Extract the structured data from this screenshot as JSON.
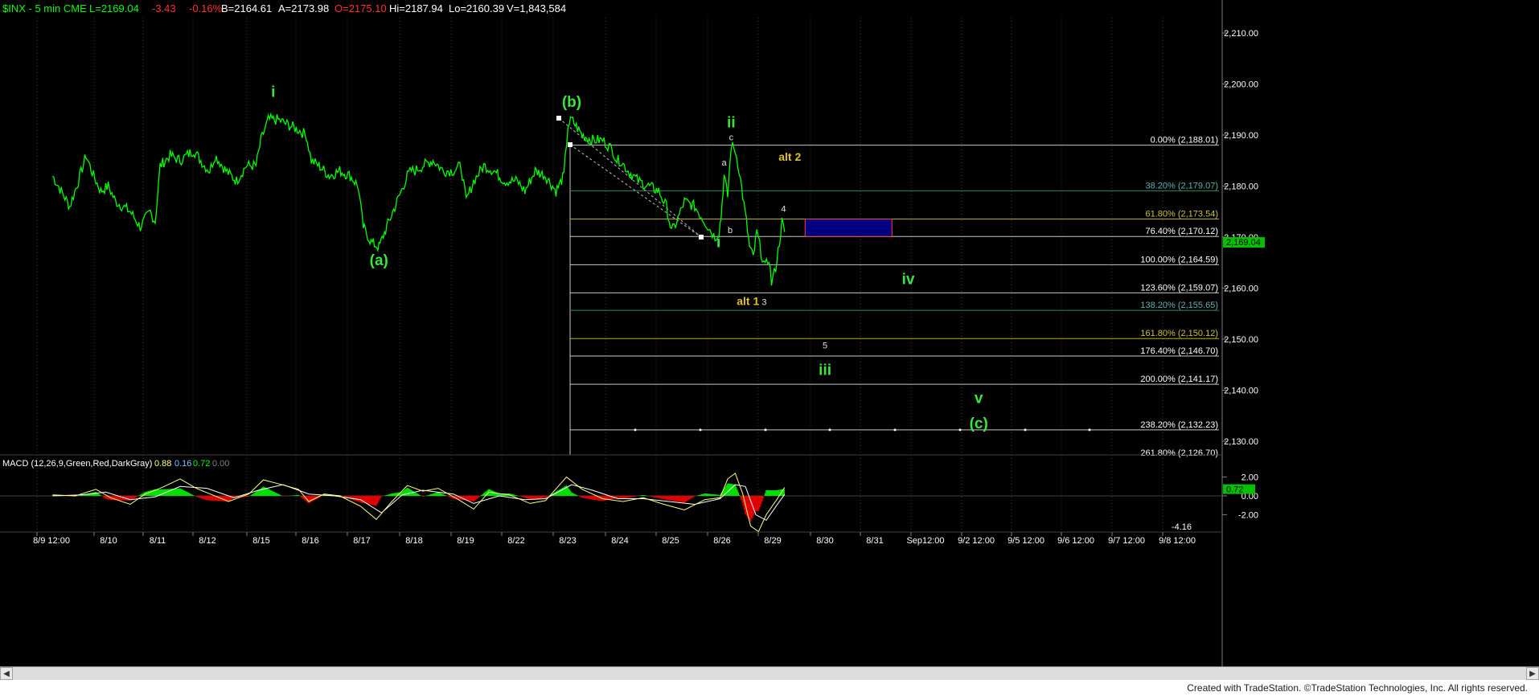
{
  "header": {
    "symbol": "$INX - 5 min  CME",
    "last": "L=2169.04",
    "change": "-3.43",
    "pct": "-0.16%",
    "bid": "B=2164.61",
    "ask": "A=2173.98",
    "open": "O=2175.10",
    "high": "Hi=2187.94",
    "low": "Lo=2160.39",
    "volume": "V=1,843,584"
  },
  "macd_header": {
    "name": "MACD (12,26,9,Green,Red,DarkGray)",
    "v1": "0.88",
    "v2": "0.16",
    "v3": "0.72",
    "v4": "0.00"
  },
  "colors": {
    "price": "#00ff00",
    "label_green": "#39e639",
    "label_yellow": "#e0c020",
    "header_green": "#00ff00",
    "header_red": "#ff3030",
    "fib_white": "#ffffff",
    "fib_green": "#2e8b57",
    "fib_yellow": "#b8b000",
    "box_fill": "#000080",
    "box_border": "#ff4040",
    "macd_line": "#ffff80",
    "macd_signal": "#ffffff",
    "hist_pos": "#00e000",
    "hist_neg": "#e00000",
    "axis_bg": "#000000"
  },
  "footer": {
    "credit": "Created with TradeStation. ©TradeStation Technologies, Inc. All rights reserved."
  },
  "chart_data": {
    "type": "line",
    "title": "$INX - 5 min",
    "x_ticks": [
      "8/9 12:00",
      "8/10",
      "8/11",
      "8/12",
      "8/15",
      "8/16",
      "8/17",
      "8/18",
      "8/19",
      "8/22",
      "8/23",
      "8/24",
      "8/25",
      "8/26",
      "8/29",
      "8/30",
      "8/31",
      "Sep12:00",
      "9/2 12:00",
      "9/5 12:00",
      "9/6 12:00",
      "9/7 12:00",
      "9/8 12:00"
    ],
    "y_ticks": [
      2130,
      2140,
      2150,
      2160,
      2170,
      2180,
      2190,
      2200,
      2210
    ],
    "ylim": [
      2125,
      2215
    ],
    "last_price": "2,169.04",
    "price_points": [
      [
        0.0,
        2182
      ],
      [
        0.15,
        2179
      ],
      [
        0.3,
        2176
      ],
      [
        0.45,
        2181
      ],
      [
        0.6,
        2186
      ],
      [
        0.75,
        2182
      ],
      [
        0.9,
        2179
      ],
      [
        1.05,
        2180
      ],
      [
        1.2,
        2177
      ],
      [
        1.5,
        2175
      ],
      [
        1.7,
        2172
      ],
      [
        1.9,
        2175
      ],
      [
        2.0,
        2173
      ],
      [
        2.1,
        2184
      ],
      [
        2.3,
        2186
      ],
      [
        2.5,
        2185
      ],
      [
        2.75,
        2187
      ],
      [
        2.95,
        2184
      ],
      [
        3.05,
        2183
      ],
      [
        3.15,
        2186
      ],
      [
        3.35,
        2183
      ],
      [
        3.55,
        2181
      ],
      [
        3.75,
        2184
      ],
      [
        3.95,
        2184
      ],
      [
        4.05,
        2189
      ],
      [
        4.2,
        2193
      ],
      [
        4.4,
        2193
      ],
      [
        4.6,
        2192
      ],
      [
        4.8,
        2191
      ],
      [
        4.95,
        2190
      ],
      [
        5.05,
        2185
      ],
      [
        5.2,
        2184
      ],
      [
        5.4,
        2182
      ],
      [
        5.6,
        2183
      ],
      [
        5.8,
        2182
      ],
      [
        5.95,
        2180
      ],
      [
        6.05,
        2172
      ],
      [
        6.2,
        2169
      ],
      [
        6.35,
        2168
      ],
      [
        6.5,
        2172
      ],
      [
        6.7,
        2177
      ],
      [
        6.9,
        2182
      ],
      [
        6.98,
        2183
      ],
      [
        7.05,
        2183
      ],
      [
        7.2,
        2184
      ],
      [
        7.4,
        2185
      ],
      [
        7.6,
        2183
      ],
      [
        7.8,
        2183
      ],
      [
        7.95,
        2184
      ],
      [
        8.05,
        2177
      ],
      [
        8.2,
        2181
      ],
      [
        8.4,
        2184
      ],
      [
        8.6,
        2183
      ],
      [
        8.8,
        2181
      ],
      [
        8.95,
        2181
      ],
      [
        9.05,
        2181
      ],
      [
        9.2,
        2179
      ],
      [
        9.4,
        2183
      ],
      [
        9.6,
        2182
      ],
      [
        9.8,
        2179
      ],
      [
        9.95,
        2182
      ],
      [
        10.03,
        2192
      ],
      [
        10.1,
        2193
      ],
      [
        10.3,
        2190
      ],
      [
        10.5,
        2189
      ],
      [
        10.7,
        2189
      ],
      [
        10.9,
        2187
      ],
      [
        10.98,
        2185
      ],
      [
        11.05,
        2185
      ],
      [
        11.2,
        2183
      ],
      [
        11.4,
        2181
      ],
      [
        11.6,
        2180
      ],
      [
        11.8,
        2179
      ],
      [
        11.95,
        2176
      ],
      [
        12.05,
        2171
      ],
      [
        12.15,
        2173
      ],
      [
        12.3,
        2177
      ],
      [
        12.5,
        2176
      ],
      [
        12.7,
        2173
      ],
      [
        12.9,
        2170
      ],
      [
        12.98,
        2171
      ],
      [
        13.02,
        2174
      ],
      [
        13.08,
        2182
      ],
      [
        13.15,
        2178
      ],
      [
        13.22,
        2188
      ],
      [
        13.3,
        2187
      ],
      [
        13.38,
        2183
      ],
      [
        13.45,
        2178
      ],
      [
        13.52,
        2173
      ],
      [
        13.58,
        2168
      ],
      [
        13.65,
        2166
      ],
      [
        13.72,
        2171
      ],
      [
        13.8,
        2167
      ],
      [
        13.88,
        2164
      ],
      [
        13.95,
        2166
      ],
      [
        14.0,
        2161
      ],
      [
        14.08,
        2164
      ],
      [
        14.15,
        2169
      ],
      [
        14.2,
        2173
      ],
      [
        14.25,
        2171
      ]
    ],
    "fibonacci": [
      {
        "pct": "0.00%",
        "value": 2188.01,
        "label": "0.00% (2,188.01)"
      },
      {
        "pct": "38.20%",
        "value": 2179.07,
        "label": "38.20% (2,179.07)"
      },
      {
        "pct": "61.80%",
        "value": 2173.54,
        "label": "61.80% (2,173.54)"
      },
      {
        "pct": "76.40%",
        "value": 2170.12,
        "label": "76.40% (2,170.12)"
      },
      {
        "pct": "100.00%",
        "value": 2164.59,
        "label": "100.00% (2,164.59)"
      },
      {
        "pct": "123.60%",
        "value": 2159.07,
        "label": "123.60% (2,159.07)"
      },
      {
        "pct": "138.20%",
        "value": 2155.65,
        "label": "138.20% (2,155.65)"
      },
      {
        "pct": "161.80%",
        "value": 2150.12,
        "label": "161.80% (2,150.12)"
      },
      {
        "pct": "176.40%",
        "value": 2146.7,
        "label": "176.40% (2,146.70)"
      },
      {
        "pct": "200.00%",
        "value": 2141.17,
        "label": "200.00% (2,141.17)"
      },
      {
        "pct": "238.20%",
        "value": 2132.23,
        "label": "238.20% (2,132.23)"
      },
      {
        "pct": "261.80%",
        "value": 2126.7,
        "label": "261.80% (2,126.70)"
      }
    ],
    "target_box": {
      "x_start": 14.65,
      "x_end": 15.0,
      "low": 2170.12,
      "high": 2173.54
    },
    "wave_labels": [
      {
        "text": "i",
        "x": 4.3,
        "y": 2197.5,
        "color": "green",
        "size": "large"
      },
      {
        "text": "(a)",
        "x": 6.35,
        "y": 2164.5,
        "color": "green",
        "size": "large"
      },
      {
        "text": "(b)",
        "x": 10.1,
        "y": 2195.5,
        "color": "green",
        "size": "large"
      },
      {
        "text": "ii",
        "x": 13.22,
        "y": 2191.5,
        "color": "green",
        "size": "large"
      },
      {
        "text": "c",
        "x": 13.22,
        "y": 2189,
        "color": "white",
        "size": "small"
      },
      {
        "text": "a",
        "x": 13.08,
        "y": 2184,
        "color": "white",
        "size": "small"
      },
      {
        "text": "b",
        "x": 13.2,
        "y": 2170.8,
        "color": "white",
        "size": "small"
      },
      {
        "text": "i",
        "x": 12.97,
        "y": 2168,
        "color": "green",
        "size": "large"
      },
      {
        "text": "alt 2",
        "x": 14.35,
        "y": 2185,
        "color": "yellow",
        "size": "medium"
      },
      {
        "text": "4",
        "x": 14.23,
        "y": 2175,
        "color": "white",
        "size": "small"
      },
      {
        "text": "alt 1",
        "x": 13.55,
        "y": 2156.7,
        "color": "yellow",
        "size": "medium"
      },
      {
        "text": "3",
        "x": 13.86,
        "y": 2156.7,
        "color": "white",
        "size": "small"
      },
      {
        "text": "iv",
        "x": 16.7,
        "y": 2160.8,
        "color": "green",
        "size": "large"
      },
      {
        "text": "5",
        "x": 15.05,
        "y": 2148.2,
        "color": "white",
        "size": "small"
      },
      {
        "text": "iii",
        "x": 15.05,
        "y": 2143,
        "color": "green",
        "size": "large"
      },
      {
        "text": "v",
        "x": 18.1,
        "y": 2137.5,
        "color": "green",
        "size": "large"
      },
      {
        "text": "(c)",
        "x": 18.1,
        "y": 2132.5,
        "color": "green",
        "size": "large"
      }
    ],
    "macd": {
      "y_ticks": [
        "2.00",
        "0.00",
        "-2.00"
      ],
      "upper_value": "0.72",
      "low_label": "-4.16",
      "ylim": [
        -4.5,
        3.0
      ],
      "macd_points": [
        [
          0,
          0.1
        ],
        [
          0.4,
          0.0
        ],
        [
          0.8,
          0.7
        ],
        [
          1.1,
          -0.2
        ],
        [
          1.5,
          -0.9
        ],
        [
          1.8,
          0.2
        ],
        [
          2.1,
          0.8
        ],
        [
          2.5,
          1.8
        ],
        [
          2.8,
          0.8
        ],
        [
          3.1,
          0.1
        ],
        [
          3.4,
          -0.6
        ],
        [
          3.8,
          0.2
        ],
        [
          4.1,
          1.7
        ],
        [
          4.4,
          1.3
        ],
        [
          4.8,
          0.7
        ],
        [
          5.0,
          -0.6
        ],
        [
          5.3,
          0.2
        ],
        [
          5.6,
          0.0
        ],
        [
          6.0,
          -1.1
        ],
        [
          6.3,
          -2.5
        ],
        [
          6.6,
          -0.6
        ],
        [
          6.9,
          1.1
        ],
        [
          7.2,
          0.5
        ],
        [
          7.5,
          0.8
        ],
        [
          7.9,
          -0.4
        ],
        [
          8.2,
          -1.4
        ],
        [
          8.5,
          0.4
        ],
        [
          8.9,
          0.1
        ],
        [
          9.3,
          -0.8
        ],
        [
          9.6,
          -0.5
        ],
        [
          10.0,
          2.0
        ],
        [
          10.3,
          0.7
        ],
        [
          10.7,
          -0.3
        ],
        [
          11.1,
          -0.6
        ],
        [
          11.5,
          -0.2
        ],
        [
          11.9,
          -0.9
        ],
        [
          12.3,
          -1.5
        ],
        [
          12.7,
          -0.4
        ],
        [
          13.0,
          -0.2
        ],
        [
          13.15,
          1.8
        ],
        [
          13.3,
          2.4
        ],
        [
          13.45,
          0.2
        ],
        [
          13.6,
          -3.2
        ],
        [
          13.75,
          -3.8
        ],
        [
          13.9,
          -2.0
        ],
        [
          14.1,
          -0.4
        ],
        [
          14.25,
          0.9
        ]
      ],
      "signal_points": [
        [
          0,
          0.0
        ],
        [
          0.5,
          0.1
        ],
        [
          1.0,
          0.4
        ],
        [
          1.5,
          -0.4
        ],
        [
          2.0,
          -0.1
        ],
        [
          2.5,
          1.0
        ],
        [
          3.0,
          0.8
        ],
        [
          3.5,
          -0.2
        ],
        [
          4.0,
          0.6
        ],
        [
          4.5,
          1.2
        ],
        [
          5.0,
          0.2
        ],
        [
          5.5,
          0.0
        ],
        [
          6.0,
          -0.4
        ],
        [
          6.4,
          -1.8
        ],
        [
          6.8,
          0.1
        ],
        [
          7.2,
          0.6
        ],
        [
          7.8,
          0.2
        ],
        [
          8.2,
          -0.8
        ],
        [
          8.7,
          0.0
        ],
        [
          9.2,
          -0.4
        ],
        [
          9.6,
          -0.3
        ],
        [
          10.1,
          1.2
        ],
        [
          10.5,
          0.6
        ],
        [
          11.0,
          -0.3
        ],
        [
          11.5,
          -0.3
        ],
        [
          12.0,
          -0.6
        ],
        [
          12.5,
          -0.9
        ],
        [
          13.0,
          -0.3
        ],
        [
          13.3,
          1.2
        ],
        [
          13.5,
          1.0
        ],
        [
          13.7,
          -2.0
        ],
        [
          13.9,
          -2.6
        ],
        [
          14.1,
          -1.0
        ],
        [
          14.25,
          0.16
        ]
      ]
    }
  }
}
